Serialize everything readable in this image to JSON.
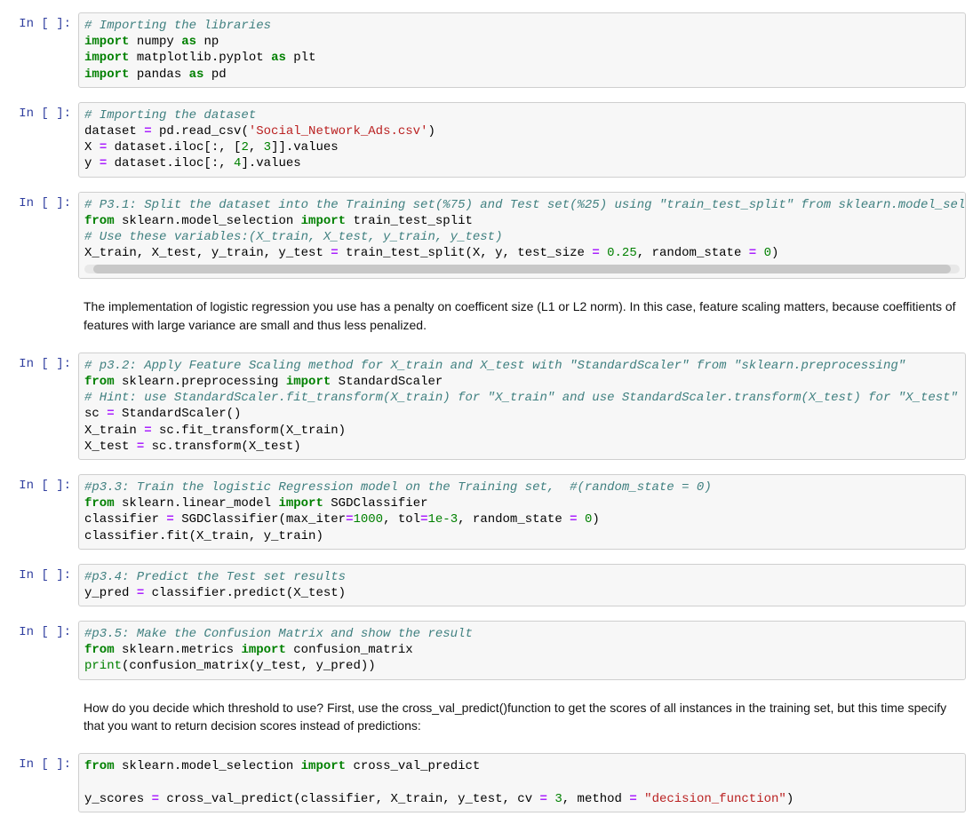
{
  "prompt_label": "In [ ]:",
  "cells": [
    {
      "type": "code",
      "html": "<span class='cm'># Importing the libraries</span>\n<span class='kw'>import</span> numpy <span class='kw'>as</span> np\n<span class='kw'>import</span> matplotlib.pyplot <span class='kw'>as</span> plt\n<span class='kw'>import</span> pandas <span class='kw'>as</span> pd"
    },
    {
      "type": "code",
      "html": "<span class='cm'># Importing the dataset</span>\ndataset <span class='op'>=</span> pd.read_csv(<span class='str'>'Social_Network_Ads.csv'</span>)\nX <span class='op'>=</span> dataset.iloc[:, [<span class='num'>2</span>, <span class='num'>3</span>]].values\ny <span class='op'>=</span> dataset.iloc[:, <span class='num'>4</span>].values"
    },
    {
      "type": "code",
      "scroll": true,
      "html": "<span class='cm'># P3.1: Split the dataset into the Training set(%75) and Test set(%25) using \"train_test_split\" from sklearn.model_sele</span>\n<span class='kw'>from</span> sklearn.model_selection <span class='kw'>import</span> train_test_split\n<span class='cm'># Use these variables:(X_train, X_test, y_train, y_test)</span>\nX_train, X_test, y_train, y_test <span class='op'>=</span> train_test_split(X, y, test_size <span class='op'>=</span> <span class='num'>0.25</span>, random_state <span class='op'>=</span> <span class='num'>0</span>)"
    },
    {
      "type": "markdown",
      "text": "The implementation of logistic regression you use has a penalty on coefficent size (L1 or L2 norm). In this case, feature scaling matters, because coeffitients of features with large variance are small and thus less penalized."
    },
    {
      "type": "code",
      "html": "<span class='cm'># p3.2: Apply Feature Scaling method for X_train and X_test with \"StandardScaler\" from \"sklearn.preprocessing\"</span>\n<span class='kw'>from</span> sklearn.preprocessing <span class='kw'>import</span> StandardScaler\n<span class='cm'># Hint: use StandardScaler.fit_transform(X_train) for \"X_train\" and use StandardScaler.transform(X_test) for \"X_test\"</span>\nsc <span class='op'>=</span> StandardScaler()\nX_train <span class='op'>=</span> sc.fit_transform(X_train)\nX_test <span class='op'>=</span> sc.transform(X_test)"
    },
    {
      "type": "code",
      "html": "<span class='cm'>#p3.3: Train the logistic Regression model on the Training set,  #(random_state = 0)</span>\n<span class='kw'>from</span> sklearn.linear_model <span class='kw'>import</span> SGDClassifier\nclassifier <span class='op'>=</span> SGDClassifier(max_iter<span class='op'>=</span><span class='num'>1000</span>, tol<span class='op'>=</span><span class='num'>1e-3</span>, random_state <span class='op'>=</span> <span class='num'>0</span>)\nclassifier.fit(X_train, y_train)"
    },
    {
      "type": "code",
      "html": "<span class='cm'>#p3.4: Predict the Test set results</span>\ny_pred <span class='op'>=</span> classifier.predict(X_test)"
    },
    {
      "type": "code",
      "html": "<span class='cm'>#p3.5: Make the Confusion Matrix and show the result</span>\n<span class='kw'>from</span> sklearn.metrics <span class='kw'>import</span> confusion_matrix\n<span class='bi'>print</span>(confusion_matrix(y_test, y_pred))"
    },
    {
      "type": "markdown",
      "text": "How do you decide which threshold to use? First, use the cross_val_predict()function to get the scores of all instances in the training set, but this time specify that you want to return decision scores instead of predictions:"
    },
    {
      "type": "code",
      "html": "<span class='kw'>from</span> sklearn.model_selection <span class='kw'>import</span> cross_val_predict\n\ny_scores <span class='op'>=</span> cross_val_predict(classifier, X_train, y_test, cv <span class='op'>=</span> <span class='num'>3</span>, method <span class='op'>=</span> <span class='str'>\"decision_function\"</span>)"
    }
  ]
}
